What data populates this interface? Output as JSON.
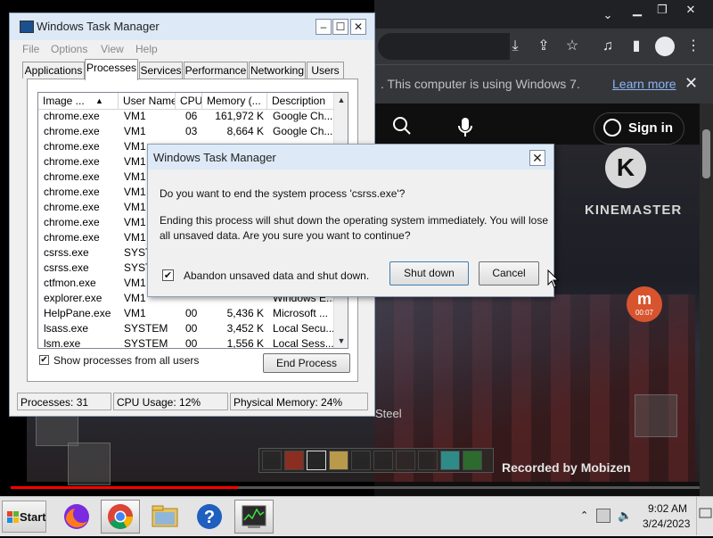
{
  "browser": {
    "infobar_text": ". This computer is using Windows 7.",
    "learn_more": "Learn more",
    "sign_in": "Sign in",
    "kinemaster": "KINEMASTER",
    "kinemaster_letter": "K",
    "rec_badge_letter": "m",
    "rec_time": "00:07",
    "steel_text": "Steel",
    "recorded_by": "Recorded by Mobizen",
    "video_progress_fraction": 0.33
  },
  "task_manager": {
    "title": "Windows Task Manager",
    "menu": [
      "File",
      "Options",
      "View",
      "Help"
    ],
    "tabs": [
      "Applications",
      "Processes",
      "Services",
      "Performance",
      "Networking",
      "Users"
    ],
    "active_tab": "Processes",
    "columns": [
      "Image ...",
      "User Name",
      "CPU",
      "Memory (...",
      "Description"
    ],
    "rows": [
      {
        "image": "chrome.exe",
        "user": "VM1",
        "cpu": "06",
        "mem": "161,972 K",
        "desc": "Google Ch..."
      },
      {
        "image": "chrome.exe",
        "user": "VM1",
        "cpu": "03",
        "mem": "8,664 K",
        "desc": "Google Ch..."
      },
      {
        "image": "chrome.exe",
        "user": "VM1",
        "cpu": "",
        "mem": "",
        "desc": ""
      },
      {
        "image": "chrome.exe",
        "user": "VM1",
        "cpu": "",
        "mem": "",
        "desc": ""
      },
      {
        "image": "chrome.exe",
        "user": "VM1",
        "cpu": "",
        "mem": "",
        "desc": ""
      },
      {
        "image": "chrome.exe",
        "user": "VM1",
        "cpu": "",
        "mem": "",
        "desc": ""
      },
      {
        "image": "chrome.exe",
        "user": "VM1",
        "cpu": "",
        "mem": "",
        "desc": ""
      },
      {
        "image": "chrome.exe",
        "user": "VM1",
        "cpu": "",
        "mem": "",
        "desc": ""
      },
      {
        "image": "chrome.exe",
        "user": "VM1",
        "cpu": "",
        "mem": "",
        "desc": ""
      },
      {
        "image": "csrss.exe",
        "user": "SYST",
        "cpu": "",
        "mem": "",
        "desc": ""
      },
      {
        "image": "csrss.exe",
        "user": "SYST",
        "cpu": "",
        "mem": "",
        "desc": ""
      },
      {
        "image": "ctfmon.exe",
        "user": "VM1",
        "cpu": "",
        "mem": "",
        "desc": ""
      },
      {
        "image": "explorer.exe",
        "user": "VM1",
        "cpu": "",
        "mem": "",
        "desc": "Windows E..."
      },
      {
        "image": "HelpPane.exe",
        "user": "VM1",
        "cpu": "00",
        "mem": "5,436 K",
        "desc": "Microsoft ..."
      },
      {
        "image": "lsass.exe",
        "user": "SYSTEM",
        "cpu": "00",
        "mem": "3,452 K",
        "desc": "Local Secu..."
      },
      {
        "image": "lsm.exe",
        "user": "SYSTEM",
        "cpu": "00",
        "mem": "1,556 K",
        "desc": "Local Sess..."
      }
    ],
    "show_all_label": "Show processes from all users",
    "show_all_checked": true,
    "end_process": "End Process",
    "status": {
      "processes": "Processes: 31",
      "cpu": "CPU Usage: 12%",
      "memory": "Physical Memory: 24%"
    }
  },
  "dialog": {
    "title": "Windows Task Manager",
    "question": "Do you want to end the system process 'csrss.exe'?",
    "warning": "Ending this process will shut down the operating system immediately.  You will lose all unsaved data.  Are you sure you want to continue?",
    "checkbox_label": "Abandon unsaved data and shut down.",
    "checkbox_checked": true,
    "shutdown": "Shut down",
    "cancel": "Cancel"
  },
  "taskbar": {
    "start": "Start",
    "apps": [
      "firefox-icon",
      "chrome-icon",
      "file-explorer-icon",
      "help-icon",
      "task-manager-icon"
    ],
    "time": "9:02 AM",
    "date": "3/24/2023"
  }
}
